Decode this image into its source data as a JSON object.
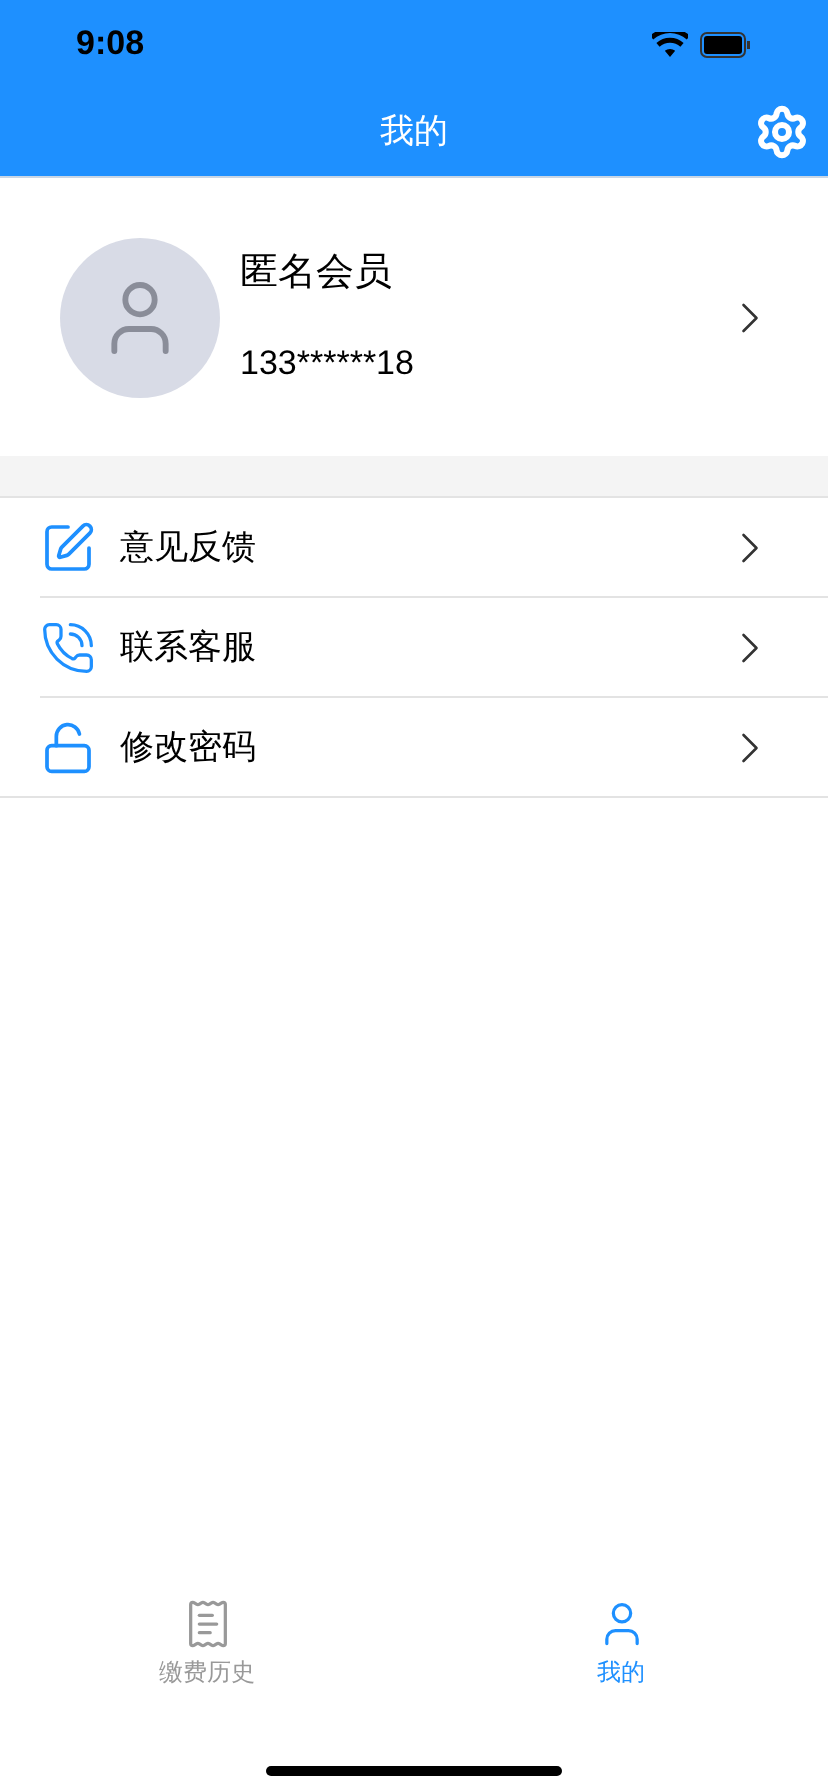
{
  "status_bar": {
    "time": "9:08"
  },
  "nav": {
    "title": "我的"
  },
  "profile": {
    "name": "匿名会员",
    "phone": "133******18"
  },
  "menu": [
    {
      "kind": "feedback",
      "label": "意见反馈"
    },
    {
      "kind": "service",
      "label": "联系客服"
    },
    {
      "kind": "password",
      "label": "修改密码"
    }
  ],
  "tabs": [
    {
      "kind": "history",
      "label": "缴费历史",
      "selected": false
    },
    {
      "kind": "me",
      "label": "我的",
      "selected": true
    }
  ]
}
